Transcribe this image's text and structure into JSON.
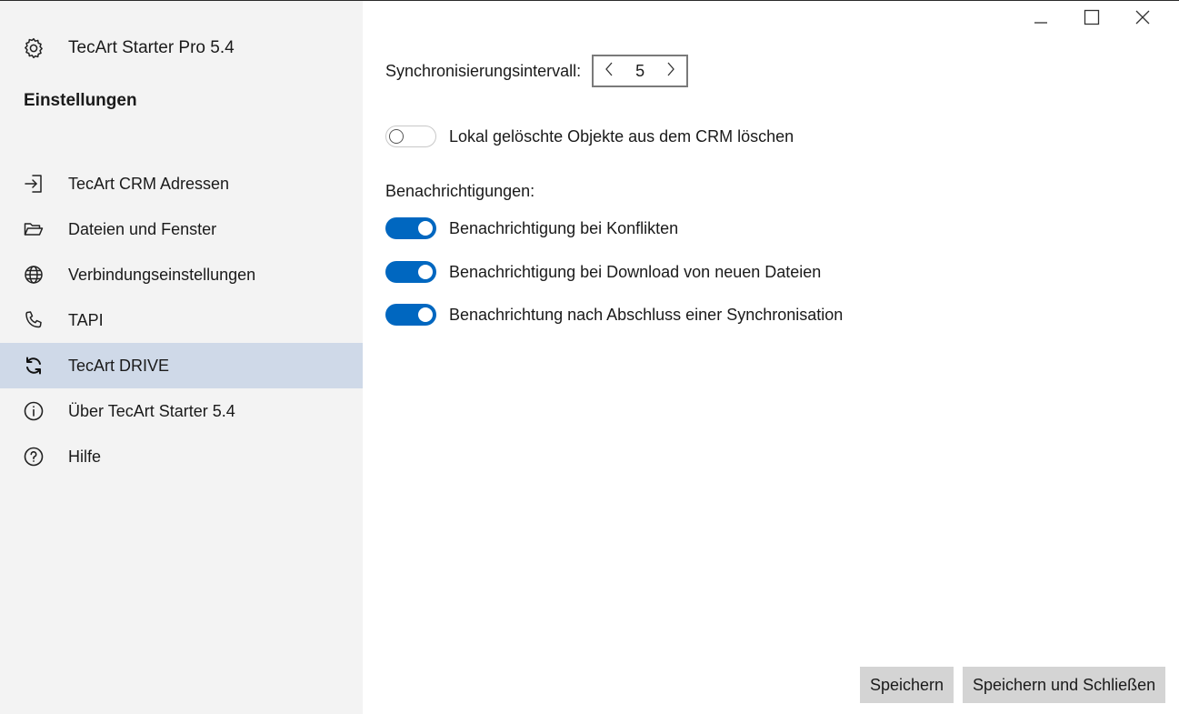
{
  "app": {
    "title": "TecArt Starter Pro 5.4",
    "header_icon": "gear-icon"
  },
  "sidebar": {
    "section_title": "Einstellungen",
    "items": [
      {
        "label": "TecArt CRM Adressen",
        "icon": "sign-in-icon",
        "active": false
      },
      {
        "label": "Dateien und Fenster",
        "icon": "folder-open-icon",
        "active": false
      },
      {
        "label": "Verbindungseinstellungen",
        "icon": "globe-icon",
        "active": false
      },
      {
        "label": "TAPI",
        "icon": "phone-icon",
        "active": false
      },
      {
        "label": "TecArt DRIVE",
        "icon": "sync-icon",
        "active": true
      },
      {
        "label": "Über TecArt Starter 5.4",
        "icon": "info-icon",
        "active": false
      },
      {
        "label": "Hilfe",
        "icon": "help-icon",
        "active": false
      }
    ]
  },
  "window_controls": {
    "minimize": "minimize-icon",
    "maximize": "maximize-icon",
    "close": "close-icon"
  },
  "settings": {
    "sync_interval_label": "Synchronisierungsintervall:",
    "sync_interval_value": "5",
    "delete_local_label": "Lokal gelöschte Objekte aus dem CRM löschen",
    "delete_local_enabled": false,
    "notifications_heading": "Benachrichtigungen:",
    "notifications": [
      {
        "label": "Benachrichtigung bei Konflikten",
        "enabled": true
      },
      {
        "label": "Benachrichtigung bei Download von neuen Dateien",
        "enabled": true
      },
      {
        "label": "Benachrichtung nach Abschluss einer Synchronisation",
        "enabled": true
      }
    ]
  },
  "buttons": {
    "save": "Speichern",
    "save_close": "Speichern und Schließen"
  },
  "colors": {
    "accent": "#0067c0",
    "sidebar_bg": "#f3f3f3",
    "active_item_bg": "#cfd9e8",
    "button_bg": "#d4d4d4"
  }
}
